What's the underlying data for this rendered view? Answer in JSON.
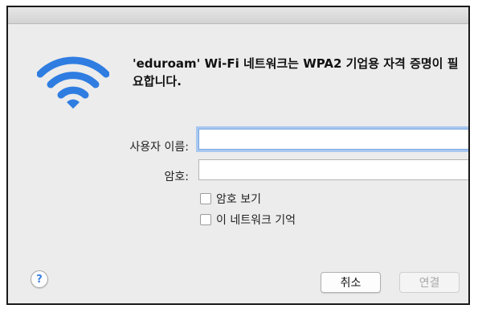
{
  "dialog": {
    "message": "'eduroam' Wi-Fi 네트워크는 WPA2 기업용 자격 증명이 필요합니다.",
    "icon": "wifi-icon",
    "accent_color": "#2f7de1"
  },
  "form": {
    "username_label": "사용자 이름:",
    "username_value": "",
    "password_label": "암호:",
    "password_value": "",
    "show_password_label": "암호 보기",
    "show_password_checked": false,
    "remember_network_label": "이 네트워크 기억",
    "remember_network_checked": false
  },
  "buttons": {
    "help": "?",
    "cancel": "취소",
    "connect": "연결"
  }
}
